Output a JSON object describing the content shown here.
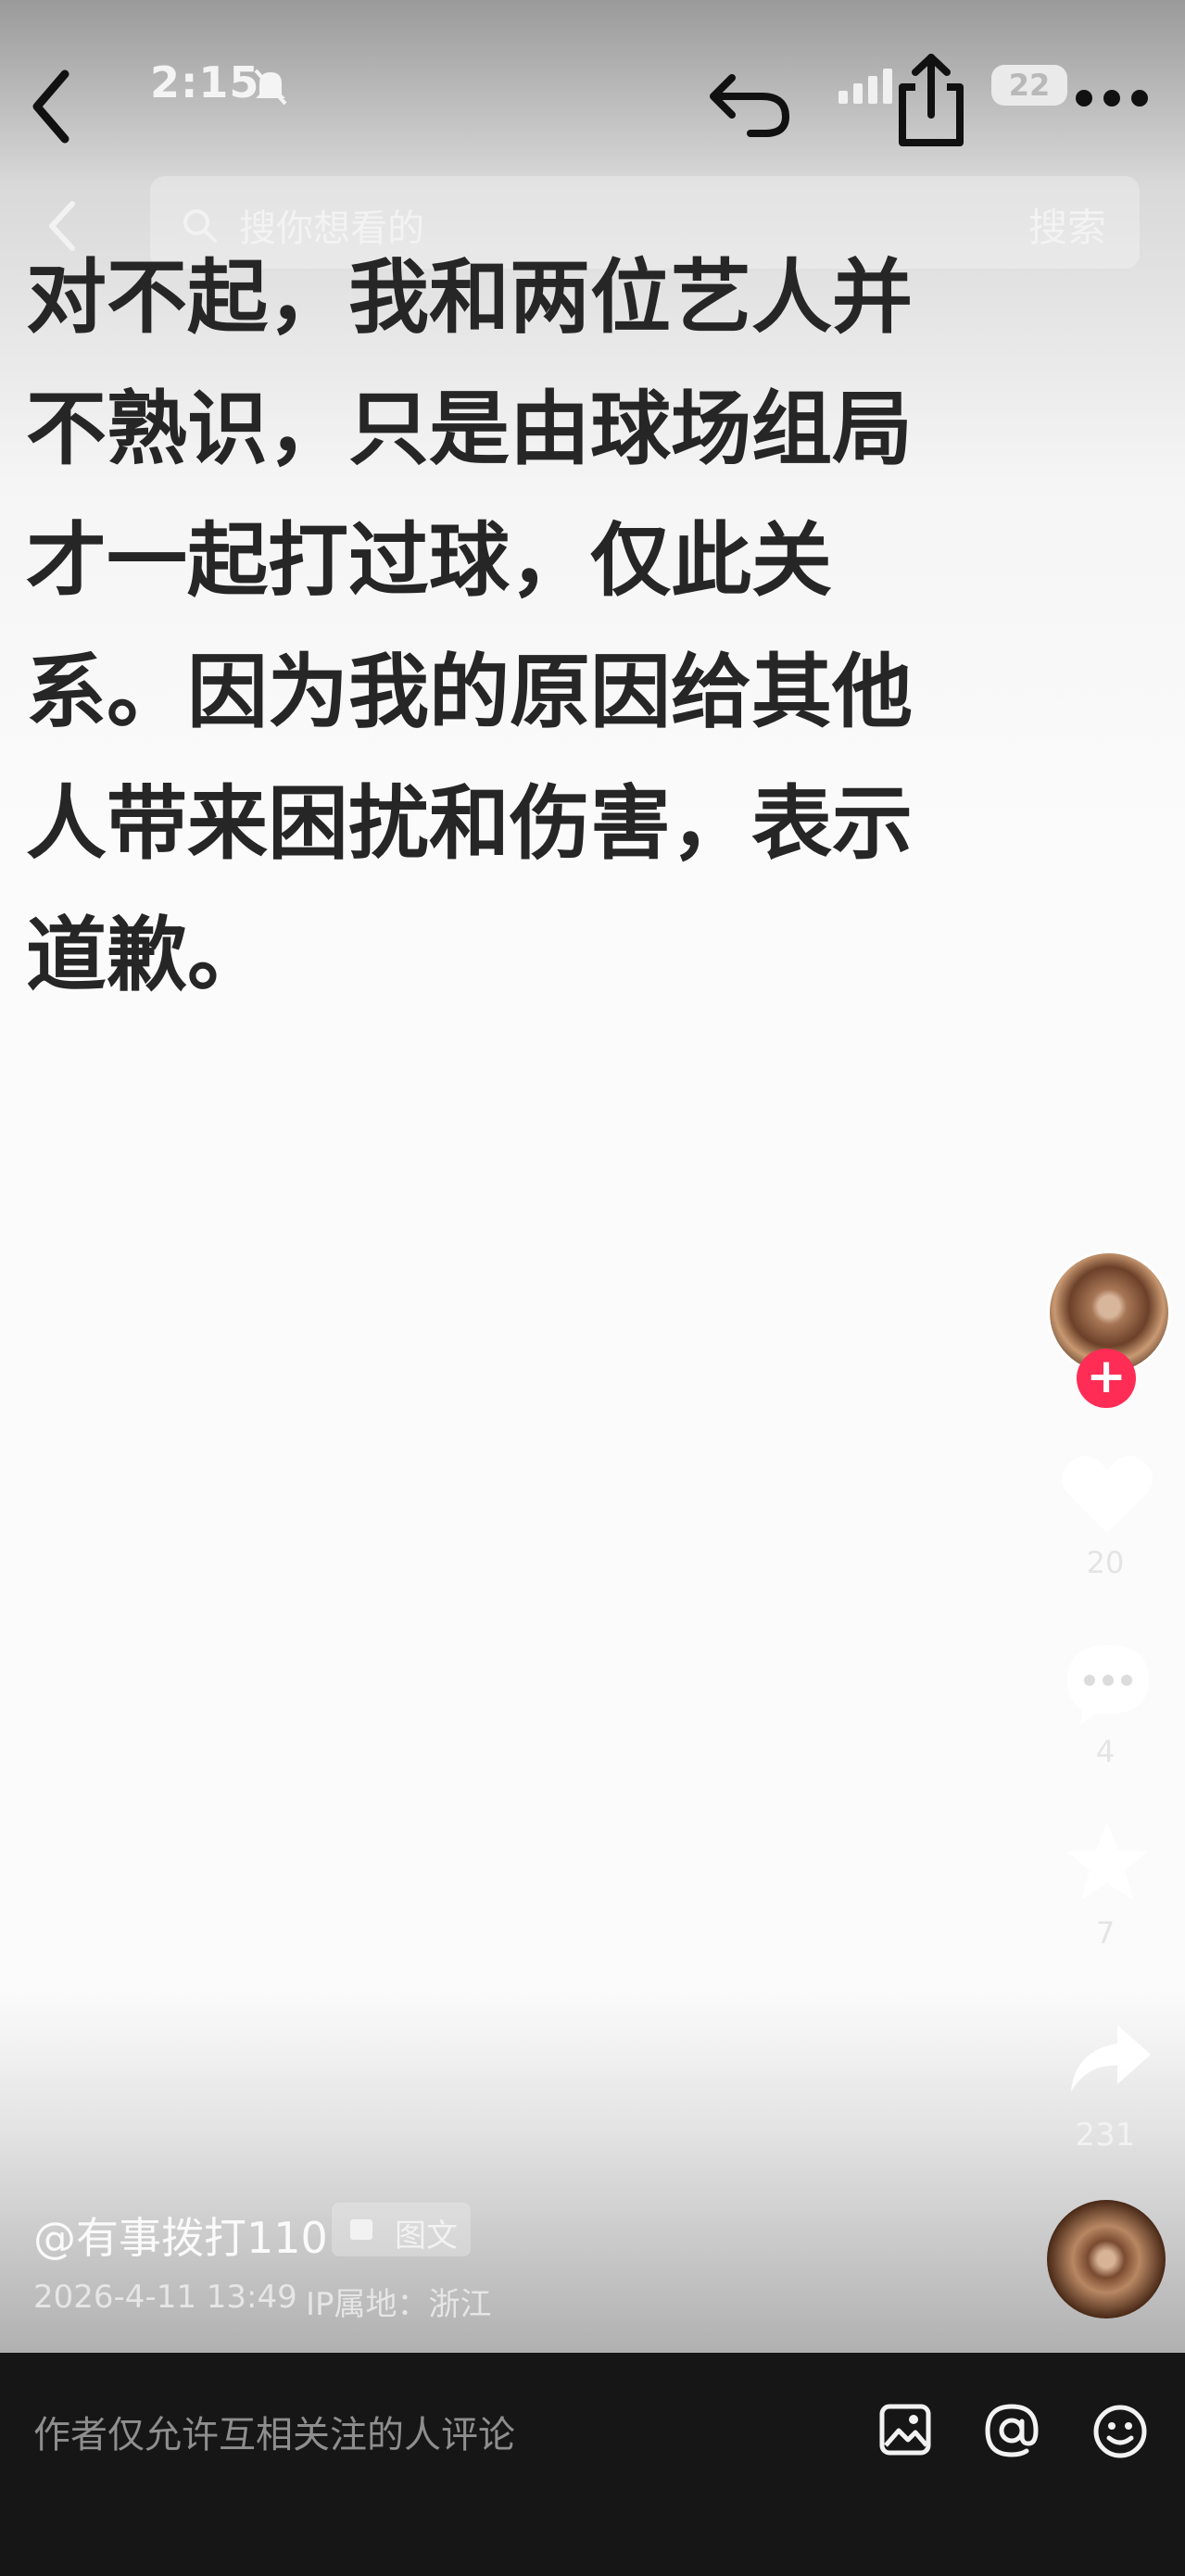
{
  "status_bar": {
    "time": "2:15",
    "battery": "22"
  },
  "search": {
    "placeholder": "搜你想看的",
    "button_label": "搜索"
  },
  "post": {
    "text": "对不起，我和两位艺人并\n不熟识，只是由球场组局\n才一起打过球，仅此关\n系。因为我的原因给其他\n人带来困扰和伤害，表示\n道歉。",
    "author_handle": "@有事拨打110",
    "type_label": "图文",
    "time": "2026-4-11 13:49",
    "ip_location": "IP属地：浙江"
  },
  "actions": {
    "likes": "20",
    "comments": "4",
    "favorites": "7",
    "shares": "231"
  },
  "comment_bar": {
    "hint": "作者仅允许互相关注的人评论"
  },
  "icons": [
    "back-icon",
    "mute-bell-icon",
    "share-arrow-icon",
    "signal-icon",
    "share-box-icon",
    "more-icon",
    "search-icon",
    "heart-icon",
    "comment-icon",
    "star-icon",
    "share-icon",
    "image-icon",
    "at-icon",
    "emoji-icon"
  ],
  "colors": {
    "follow_button": "#ff2c55",
    "comment_bar": "#161616"
  }
}
